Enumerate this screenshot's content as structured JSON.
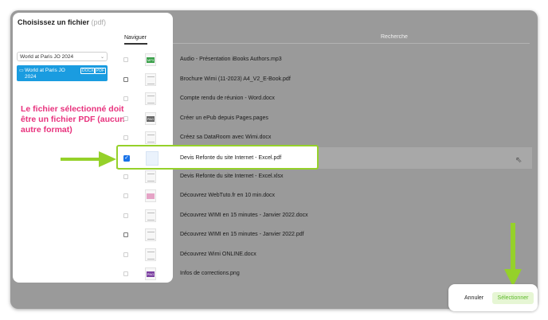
{
  "dialog": {
    "title": "Choisissez un fichier",
    "title_ext": "(pdf)",
    "tab_browse": "Naviguer",
    "search_label": "Recherche"
  },
  "sidebar": {
    "location": "World at Paris JO 2024",
    "folder_name": "World at Paris JO 2024",
    "folder_tags": [
      "DOCX",
      "PDF"
    ]
  },
  "annotation": {
    "note": "Le fichier sélectionné doit être un fichier PDF (aucun autre format)",
    "arrow_color": "#95d12a",
    "note_color": "#e8327d"
  },
  "files": [
    {
      "name": "Audio - Présentation iBooks Authors.mp3",
      "thumb": "MP3",
      "checkbox": "light"
    },
    {
      "name": "Brochure Wimi (11-2023) A4_V2_E-Book.pdf",
      "thumb": "doc",
      "checkbox": "dark"
    },
    {
      "name": "Compte rendu de réunion - Word.docx",
      "thumb": "doc",
      "checkbox": "light"
    },
    {
      "name": "Créer un ePub depuis Pages.pages",
      "thumb": "PAG",
      "checkbox": "light"
    },
    {
      "name": "Créez sa DataRoom avec Wimi.docx",
      "thumb": "doc",
      "checkbox": "light"
    },
    {
      "name": "Devis Refonte du site Internet - Excel.pdf",
      "thumb": "pdf",
      "checkbox": "checked",
      "selected": true
    },
    {
      "name": "Devis Refonte du site Internet - Excel.xlsx",
      "thumb": "doc",
      "checkbox": "light"
    },
    {
      "name": "Découvrez WebTuto.fr en 10 min.docx",
      "thumb": "img",
      "checkbox": "light"
    },
    {
      "name": "Découvrez WIMI en 15 minutes - Janvier 2022.docx",
      "thumb": "doc",
      "checkbox": "light"
    },
    {
      "name": "Découvrez WIMI en 15 minutes - Janvier 2022.pdf",
      "thumb": "doc",
      "checkbox": "dark"
    },
    {
      "name": "Découvrez Wimi ONLINE.docx",
      "thumb": "doc",
      "checkbox": "light"
    },
    {
      "name": "Infos de corrections.png",
      "thumb": "PNG",
      "checkbox": "light"
    }
  ],
  "footer": {
    "cancel_label": "Annuler",
    "select_label": "Sélectionner"
  }
}
